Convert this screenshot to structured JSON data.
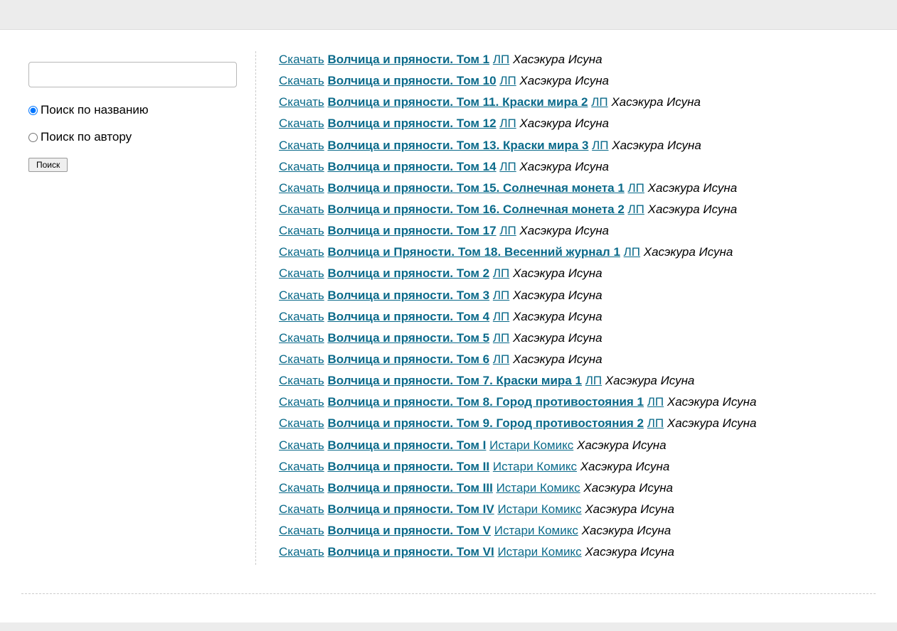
{
  "sidebar": {
    "search_value": "",
    "radio_title": "Поиск по названию",
    "radio_author": "Поиск по автору",
    "search_button": "Поиск"
  },
  "download_label": "Скачать",
  "books": [
    {
      "title": "Волчица и пряности. Том 1",
      "series": "ЛП",
      "author": "Хасэкура Исуна"
    },
    {
      "title": "Волчица и пряности. Том 10",
      "series": "ЛП",
      "author": "Хасэкура Исуна"
    },
    {
      "title": "Волчица и пряности. Том 11. Краски мира 2",
      "series": "ЛП",
      "author": "Хасэкура Исуна"
    },
    {
      "title": "Волчица и пряности. Том 12",
      "series": "ЛП",
      "author": "Хасэкура Исуна"
    },
    {
      "title": "Волчица и пряности. Том 13. Краски мира 3",
      "series": "ЛП",
      "author": "Хасэкура Исуна"
    },
    {
      "title": "Волчица и пряности. Том 14",
      "series": "ЛП",
      "author": "Хасэкура Исуна"
    },
    {
      "title": "Волчица и пряности. Том 15. Солнечная монета 1",
      "series": "ЛП",
      "author": "Хасэкура Исуна"
    },
    {
      "title": "Волчица и пряности. Том 16. Солнечная монета 2",
      "series": "ЛП",
      "author": "Хасэкура Исуна"
    },
    {
      "title": "Волчица и пряности. Том 17",
      "series": "ЛП",
      "author": "Хасэкура Исуна"
    },
    {
      "title": "Волчица и Пряности. Том 18. Весенний журнал 1",
      "series": "ЛП",
      "author": "Хасэкура Исуна"
    },
    {
      "title": "Волчица и пряности. Том 2",
      "series": "ЛП",
      "author": "Хасэкура Исуна"
    },
    {
      "title": "Волчица и пряности. Том 3",
      "series": "ЛП",
      "author": "Хасэкура Исуна"
    },
    {
      "title": "Волчица и пряности. Том 4",
      "series": "ЛП",
      "author": "Хасэкура Исуна"
    },
    {
      "title": "Волчица и пряности. Том 5",
      "series": "ЛП",
      "author": "Хасэкура Исуна"
    },
    {
      "title": "Волчица и пряности. Том 6",
      "series": "ЛП",
      "author": "Хасэкура Исуна"
    },
    {
      "title": "Волчица и пряности. Том 7. Краски мира 1",
      "series": "ЛП",
      "author": "Хасэкура Исуна"
    },
    {
      "title": "Волчица и пряности. Том 8. Город противостояния 1",
      "series": "ЛП",
      "author": "Хасэкура Исуна"
    },
    {
      "title": "Волчица и пряности. Том 9. Город противостояния 2",
      "series": "ЛП",
      "author": "Хасэкура Исуна"
    },
    {
      "title": "Волчица и пряности. Том I",
      "series": "Истари Комикс",
      "author": "Хасэкура Исуна"
    },
    {
      "title": "Волчица и пряности. Том II",
      "series": "Истари Комикс",
      "author": "Хасэкура Исуна"
    },
    {
      "title": "Волчица и пряности. Том III",
      "series": "Истари Комикс",
      "author": "Хасэкура Исуна"
    },
    {
      "title": "Волчица и пряности. Том IV",
      "series": "Истари Комикс",
      "author": "Хасэкура Исуна"
    },
    {
      "title": "Волчица и пряности. Том V",
      "series": "Истари Комикс",
      "author": "Хасэкура Исуна"
    },
    {
      "title": "Волчица и пряности. Том VI",
      "series": "Истари Комикс",
      "author": "Хасэкура Исуна"
    }
  ]
}
